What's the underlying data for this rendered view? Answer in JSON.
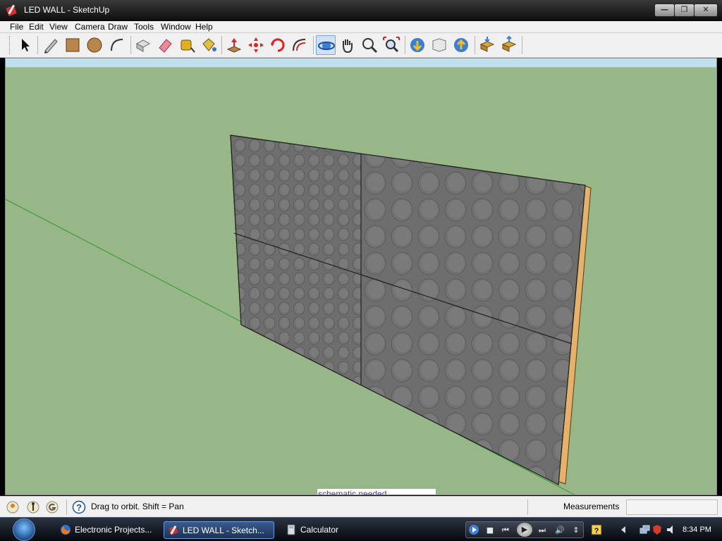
{
  "window": {
    "title": "LED WALL - SketchUp",
    "minimize_glyph": "—",
    "maximize_glyph": "❐",
    "close_glyph": "✕"
  },
  "menu": [
    {
      "label": "File"
    },
    {
      "label": "Edit"
    },
    {
      "label": "View"
    },
    {
      "label": "Camera"
    },
    {
      "label": "Draw"
    },
    {
      "label": "Tools"
    },
    {
      "label": "Window"
    },
    {
      "label": "Help"
    }
  ],
  "toolbar": {
    "tools": [
      "select-icon",
      "pencil-icon",
      "rectangle-icon",
      "circle-icon",
      "arc-icon",
      "make-component-icon",
      "eraser-icon",
      "tape-measure-icon",
      "paint-bucket-icon",
      "push-pull-icon",
      "move-icon",
      "rotate-icon",
      "offset-icon",
      "orbit-icon",
      "pan-icon",
      "zoom-icon",
      "zoom-extents-icon",
      "get-models-icon",
      "share-model-icon",
      "upload-icon",
      "get-component-icon",
      "share-component-icon"
    ],
    "active_tool": "orbit-icon"
  },
  "viewport": {
    "sky_color": "#bfe0ef",
    "ground_color": "#98b789",
    "note_text": "schematic needed"
  },
  "statusbar": {
    "icons": [
      "geo-location-icon",
      "credits-icon",
      "google-sign-in-icon",
      "help-icon"
    ],
    "message": "Drag to orbit.  Shift = Pan",
    "measurements_label": "Measurements",
    "measurements_value": ""
  },
  "taskbar": {
    "items": [
      {
        "label": "Electronic Projects...",
        "icon": "firefox-icon",
        "active": false
      },
      {
        "label": "LED WALL - Sketch...",
        "icon": "sketchup-icon",
        "active": true
      },
      {
        "label": "Calculator",
        "icon": "calculator-icon",
        "active": false
      }
    ],
    "clock": "8:34 PM"
  }
}
